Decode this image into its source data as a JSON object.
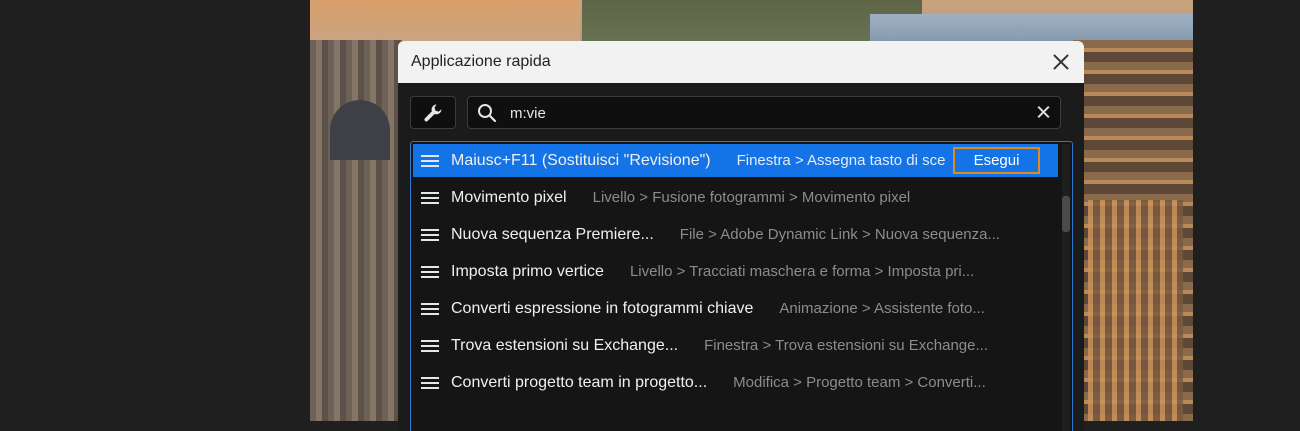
{
  "dialog": {
    "title": "Applicazione rapida"
  },
  "search": {
    "value": "m:vie",
    "placeholder": ""
  },
  "results": [
    {
      "command": "Maiusc+F11 (Sostituisci \"Revisione\")",
      "path": "Finestra > Assegna tasto di sce",
      "selected": true
    },
    {
      "command": "Movimento pixel",
      "path": "Livello > Fusione fotogrammi > Movimento pixel",
      "selected": false
    },
    {
      "command": "Nuova sequenza Premiere...",
      "path": "File > Adobe Dynamic Link > Nuova sequenza...",
      "selected": false
    },
    {
      "command": "Imposta primo vertice",
      "path": "Livello > Tracciati maschera e forma > Imposta pri...",
      "selected": false
    },
    {
      "command": "Converti espressione in fotogrammi chiave",
      "path": "Animazione > Assistente foto...",
      "selected": false
    },
    {
      "command": "Trova estensioni su Exchange...",
      "path": "Finestra > Trova estensioni su Exchange...",
      "selected": false
    },
    {
      "command": "Converti progetto team in progetto...",
      "path": "Modifica > Progetto team > Converti...",
      "selected": false
    }
  ],
  "run_button": {
    "label": "Esegui"
  },
  "icons": {
    "wrench": "wrench-icon",
    "search": "search-icon",
    "clear": "clear-icon",
    "close": "close-icon",
    "menu": "menu-icon"
  },
  "colors": {
    "accent": "#1473e6",
    "focus": "#e08a1b",
    "titlebar": "#f2f2f2",
    "panel": "#1b1b1b"
  }
}
